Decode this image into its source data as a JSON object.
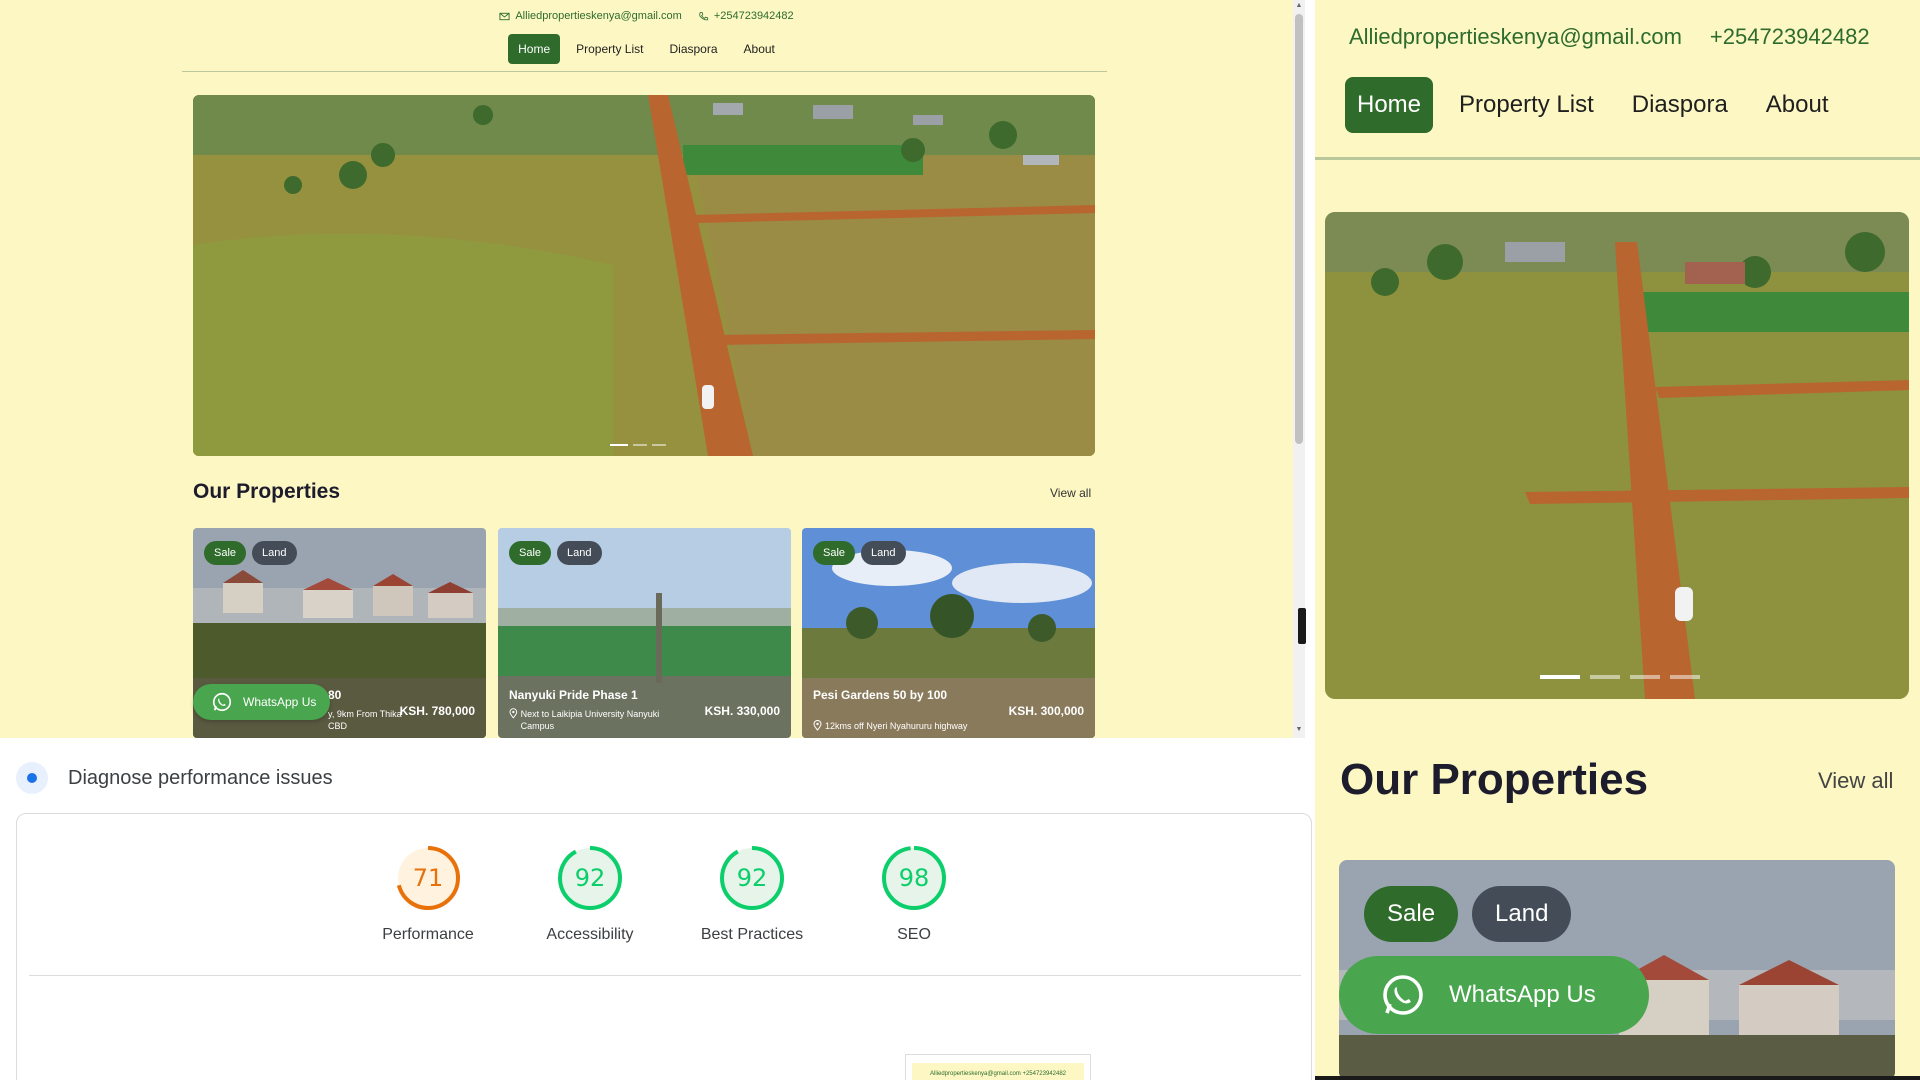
{
  "site": {
    "email": "Alliedpropertieskenya@gmail.com",
    "phone": "+254723942482",
    "nav": [
      {
        "label": "Home",
        "active": true
      },
      {
        "label": "Property List",
        "active": false
      },
      {
        "label": "Diaspora",
        "active": false
      },
      {
        "label": "About",
        "active": false
      }
    ],
    "section_title": "Our Properties",
    "view_all": "View all",
    "whatsapp_label": "WhatsApp Us",
    "cards": [
      {
        "badge_sale": "Sale",
        "badge_land": "Land",
        "title": "80",
        "location": "y, 9km From Thika CBD",
        "price": "KSH. 780,000"
      },
      {
        "badge_sale": "Sale",
        "badge_land": "Land",
        "title": "Nanyuki Pride Phase 1",
        "location": "Next to Laikipia University Nanyuki Campus",
        "price": "KSH. 330,000"
      },
      {
        "badge_sale": "Sale",
        "badge_land": "Land",
        "title": "Pesi Gardens 50 by 100",
        "location": "12kms off Nyeri Nyahururu highway",
        "price": "KSH. 300,000"
      }
    ],
    "hero_slides": 4,
    "hero_active_slide": 1
  },
  "diagnose": {
    "title": "Diagnose performance issues",
    "scores": [
      {
        "label": "Performance",
        "value": 71,
        "color": "#e8710a",
        "fill": "#fff3e0"
      },
      {
        "label": "Accessibility",
        "value": 92,
        "color": "#0cce6b",
        "fill": "#e6f4ea"
      },
      {
        "label": "Best Practices",
        "value": 92,
        "color": "#0cce6b",
        "fill": "#e6f4ea"
      },
      {
        "label": "SEO",
        "value": 98,
        "color": "#0cce6b",
        "fill": "#e6f4ea"
      }
    ],
    "thumbnail_text": "Alliedpropertieskenya@gmail.com  +254723942482"
  },
  "zoom": {
    "email": "Alliedpropertieskenya@gmail.com",
    "phone": "+254723942482",
    "nav": [
      "Home",
      "Property List",
      "Diaspora",
      "About"
    ],
    "section_title": "Our Properties",
    "view_all": "View all",
    "badge_sale": "Sale",
    "badge_land": "Land",
    "whatsapp_label": "WhatsApp Us"
  },
  "colors": {
    "site_bg": "#fdf8c3",
    "brand_green": "#2f6b2b",
    "whatsapp_green": "#4aa54f",
    "badge_gray": "#434c57"
  },
  "icons": [
    "mail-icon",
    "phone-icon",
    "whatsapp-icon",
    "location-pin-icon",
    "lighthouse-icon"
  ]
}
